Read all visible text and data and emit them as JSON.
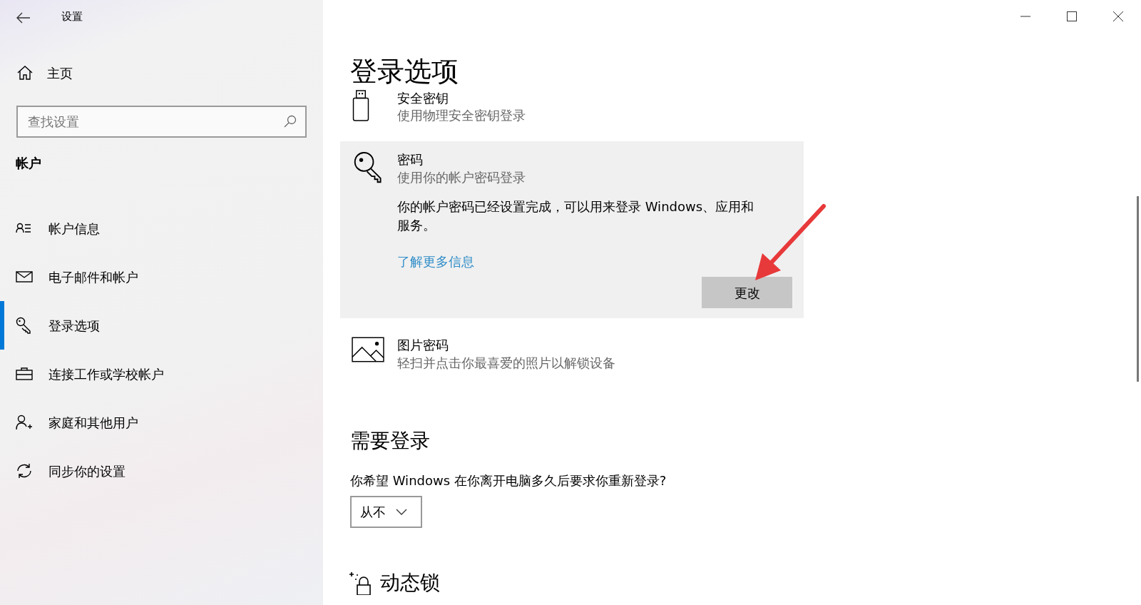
{
  "window": {
    "title": "设置"
  },
  "sidebar": {
    "home": "主页",
    "search": {
      "placeholder": "查找设置"
    },
    "section": "帐户",
    "items": [
      {
        "label": "帐户信息",
        "kind": "person-list",
        "selected": false
      },
      {
        "label": "电子邮件和帐户",
        "kind": "mail",
        "selected": false
      },
      {
        "label": "登录选项",
        "kind": "key",
        "selected": true
      },
      {
        "label": "连接工作或学校帐户",
        "kind": "briefcase",
        "selected": false
      },
      {
        "label": "家庭和其他用户",
        "kind": "person-add",
        "selected": false
      },
      {
        "label": "同步你的设置",
        "kind": "sync",
        "selected": false
      }
    ]
  },
  "page": {
    "title": "登录选项",
    "options": [
      {
        "kind": "usb-key",
        "title": "安全密钥",
        "subtitle": "使用物理安全密钥登录",
        "expanded": false
      },
      {
        "kind": "key",
        "title": "密码",
        "subtitle": "使用你的帐户密码登录",
        "expanded": true,
        "description": "你的帐户密码已经设置完成，可以用来登录 Windows、应用和服务。",
        "link": "了解更多信息",
        "button": "更改"
      },
      {
        "kind": "picture",
        "title": "图片密码",
        "subtitle": "轻扫并点击你最喜爱的照片以解锁设备",
        "expanded": false
      }
    ],
    "require_signin": {
      "title": "需要登录",
      "question": "你希望 Windows 在你离开电脑多久后要求你重新登录?",
      "value": "从不"
    },
    "dynamic_lock": {
      "title": "动态锁"
    }
  }
}
